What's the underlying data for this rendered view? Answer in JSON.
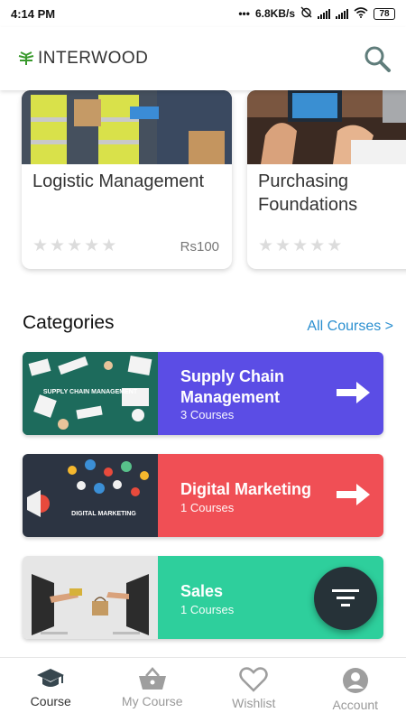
{
  "status_bar": {
    "time": "4:14 PM",
    "network_speed": "6.8KB/s",
    "battery": "78"
  },
  "header": {
    "logo_text": "INTERWOOD",
    "search_icon": "search-icon"
  },
  "courses": [
    {
      "title": "Logistic Management",
      "price": "Rs100",
      "rating": 0
    },
    {
      "title": "Purchasing Foundations",
      "price": "",
      "rating": 0
    }
  ],
  "categories_section": {
    "heading": "Categories",
    "all_courses_link": "All Courses >"
  },
  "categories": [
    {
      "name": "Supply Chain Management",
      "count": "3 Courses",
      "image_caption": "SUPPLY CHAIN MANAGEMENT",
      "color": "#5b4de5"
    },
    {
      "name": "Digital Marketing",
      "count": "1 Courses",
      "image_caption": "DIGITAL MARKETING",
      "color": "#f04f55"
    },
    {
      "name": "Sales",
      "count": "1 Courses",
      "color": "#2ecf9c"
    }
  ],
  "bottom_nav": [
    {
      "label": "Course",
      "icon": "graduation-cap-icon",
      "active": true
    },
    {
      "label": "My Course",
      "icon": "basket-icon",
      "active": false
    },
    {
      "label": "Wishlist",
      "icon": "heart-icon",
      "active": false
    },
    {
      "label": "Account",
      "icon": "account-icon",
      "active": false
    }
  ]
}
